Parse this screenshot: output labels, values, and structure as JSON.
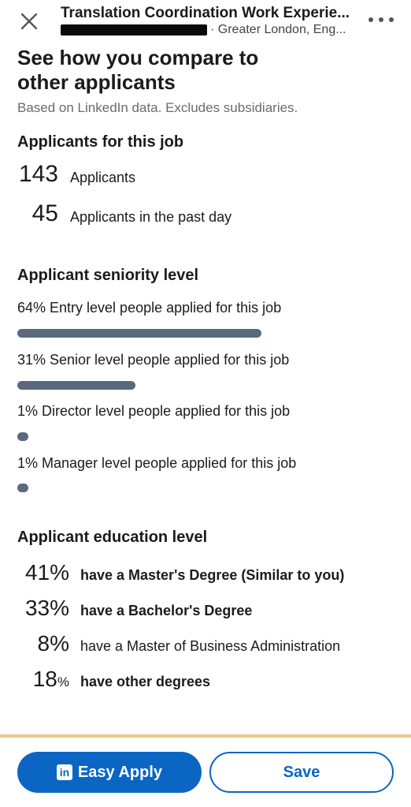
{
  "header": {
    "title": "Translation Coordination Work Experie...",
    "location": "· Greater London, Eng...",
    "close_icon": "close-icon",
    "more_icon": "more-horizontal-icon"
  },
  "comparison": {
    "heading": "See how you compare to other applicants",
    "note": "Based on LinkedIn data. Excludes subsidiaries."
  },
  "applicants": {
    "title": "Applicants for this job",
    "rows": [
      {
        "value": "143",
        "label": "Applicants"
      },
      {
        "value": "45",
        "label": "Applicants in the past day"
      }
    ]
  },
  "seniority": {
    "title": "Applicant seniority level",
    "bar_color": "#5a6a7c",
    "rows": [
      {
        "text": "64% Entry level people applied for this job",
        "percent": 64
      },
      {
        "text": "31% Senior level people applied for this job",
        "percent": 31
      },
      {
        "text": "1% Director level people applied for this job",
        "percent": 1
      },
      {
        "text": "1% Manager level people applied for this job",
        "percent": 1
      }
    ]
  },
  "education": {
    "title": "Applicant education level",
    "rows": [
      {
        "value": "41",
        "sign": "%",
        "label": "have a Master's Degree (Similar to you)"
      },
      {
        "value": "33",
        "sign": "%",
        "label": "have a Bachelor's Degree"
      },
      {
        "value": "8",
        "sign": "%",
        "label": "have a Master of Business Administration"
      },
      {
        "value": "18",
        "sign": "%",
        "label": "have other degrees"
      }
    ]
  },
  "actions": {
    "apply_label": "Easy Apply",
    "apply_icon": "linkedin-icon",
    "apply_icon_text": "in",
    "save_label": "Save",
    "accent": "#0a66c2"
  }
}
